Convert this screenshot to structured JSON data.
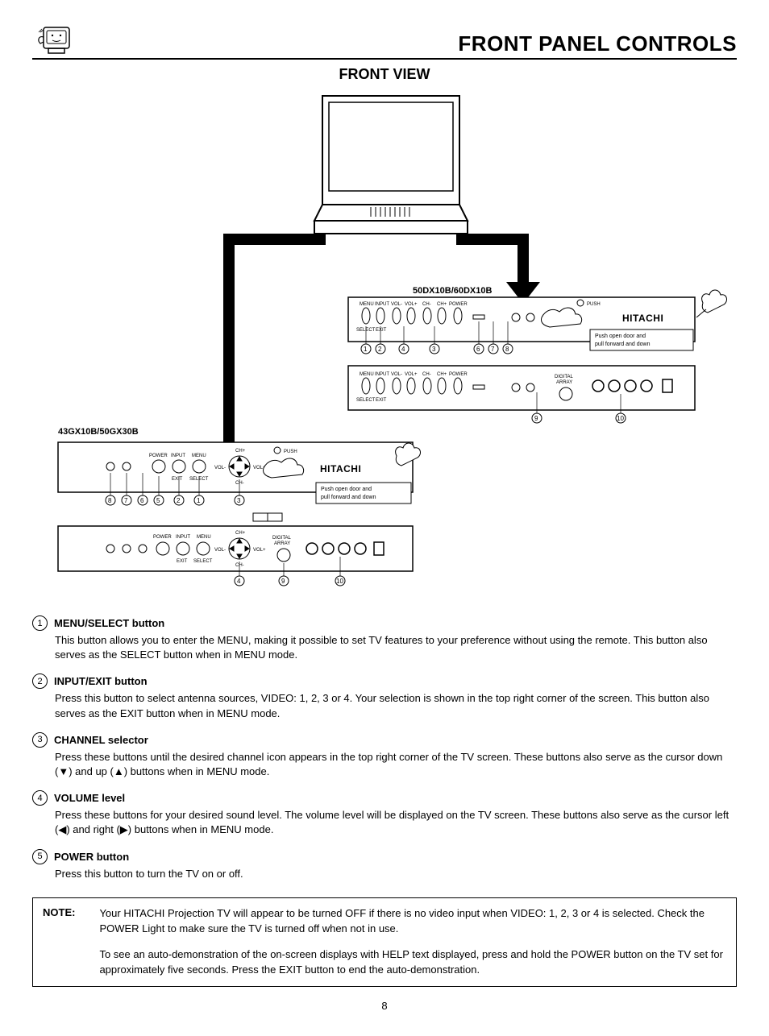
{
  "header": {
    "title": "FRONT PANEL CONTROLS"
  },
  "front_view_title": "FRONT VIEW",
  "diagram": {
    "model_top": "50DX10B/60DX10B",
    "model_left": "43GX10B/50GX30B",
    "brand": "HITACHI",
    "push_label": "PUSH",
    "door_hint_1": "Push open door and",
    "door_hint_2": "pull forward and down",
    "digital_array_1": "DIGITAL",
    "digital_array_2": "ARRAY",
    "btn_menu": "MENU",
    "btn_input": "INPUT",
    "btn_volminus": "VOL-",
    "btn_volplus": "VOL+",
    "btn_chminus": "CH-",
    "btn_chplus": "CH+",
    "btn_power": "POWER",
    "btn_select": "SELECT",
    "btn_exit": "EXIT",
    "lbl_power": "POWER",
    "lbl_input": "INPUT",
    "lbl_menu": "MENU"
  },
  "items": [
    {
      "num": "1",
      "title": "MENU/SELECT button",
      "body": "This button allows you to enter the MENU, making it possible to set TV features to your preference without using the remote.  This button also serves as the SELECT button when in MENU mode."
    },
    {
      "num": "2",
      "title": "INPUT/EXIT button",
      "body": "Press this button to select antenna sources, VIDEO: 1, 2, 3 or 4.  Your selection is shown in the top right corner of the screen.  This button also serves as the EXIT button when in MENU mode."
    },
    {
      "num": "3",
      "title": "CHANNEL selector",
      "body": "Press these buttons until the desired channel icon appears in the top right corner of the TV screen.  These buttons also serve as the cursor down (▼) and up (▲) buttons when in MENU mode."
    },
    {
      "num": "4",
      "title": "VOLUME level",
      "body": "Press these buttons for your desired sound level.  The volume level will be displayed on the TV screen.  These buttons also serve as the cursor left (◀) and right (▶) buttons when in MENU mode."
    },
    {
      "num": "5",
      "title": "POWER button",
      "body": "Press this button to turn the TV on or off."
    }
  ],
  "note": {
    "label": "NOTE:",
    "p1": "Your HITACHI Projection TV will appear to be turned OFF if there is no video input when VIDEO: 1, 2, 3 or 4 is selected.  Check the POWER Light to make sure the TV is turned off when not in use.",
    "p2": "To see an auto-demonstration of the on-screen displays with HELP text displayed, press and hold the POWER button on the TV set for approximately five seconds.  Press the EXIT button to end the auto-demonstration."
  },
  "page_number": "8"
}
